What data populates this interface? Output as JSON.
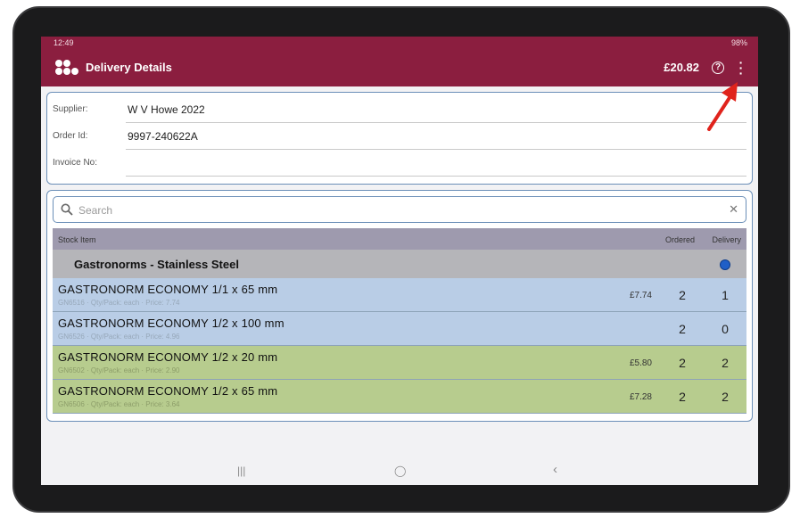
{
  "status_bar": {
    "time": "12:49",
    "system": "98%"
  },
  "app_bar": {
    "title": "Delivery Details",
    "total": "£20.82",
    "help_icon": "help-circle-icon",
    "more_icon": "more-vert-icon"
  },
  "header": {
    "supplier_label": "Supplier:",
    "supplier_value": "W V Howe 2022",
    "order_label": "Order Id:",
    "order_value": "9997-240622A",
    "invoice_label": "Invoice No:",
    "invoice_value": ""
  },
  "search": {
    "placeholder": "Search",
    "value": ""
  },
  "table": {
    "headers": {
      "item": "Stock Item",
      "ordered": "Ordered",
      "delivery": "Delivery"
    },
    "group": {
      "title": "Gastronorms - Stainless Steel"
    },
    "rows": [
      {
        "name": "GASTRONORM ECONOMY  1/1 x 65 mm",
        "sub": "GN6516 · Qty/Pack: each · Price: 7.74",
        "price": "£7.74",
        "ordered": "2",
        "delivery": "1",
        "status": "blue"
      },
      {
        "name": "GASTRONORM ECONOMY  1/2 x 100 mm",
        "sub": "GN6526 · Qty/Pack: each · Price: 4.96",
        "price": "",
        "ordered": "2",
        "delivery": "0",
        "status": "blue"
      },
      {
        "name": "GASTRONORM ECONOMY  1/2 x 20 mm",
        "sub": "GN6502 · Qty/Pack: each · Price: 2.90",
        "price": "£5.80",
        "ordered": "2",
        "delivery": "2",
        "status": "green"
      },
      {
        "name": "GASTRONORM ECONOMY  1/2 x 65 mm",
        "sub": "GN6506 · Qty/Pack: each · Price: 3.64",
        "price": "£7.28",
        "ordered": "2",
        "delivery": "2",
        "status": "green"
      }
    ]
  },
  "nav": {
    "recents": "|||",
    "home": "◯",
    "back": "‹"
  },
  "colors": {
    "brand": "#8b1e3f",
    "row_blue": "#b9cde6",
    "row_green": "#b7cc8e",
    "annotation": "#e0231c"
  }
}
